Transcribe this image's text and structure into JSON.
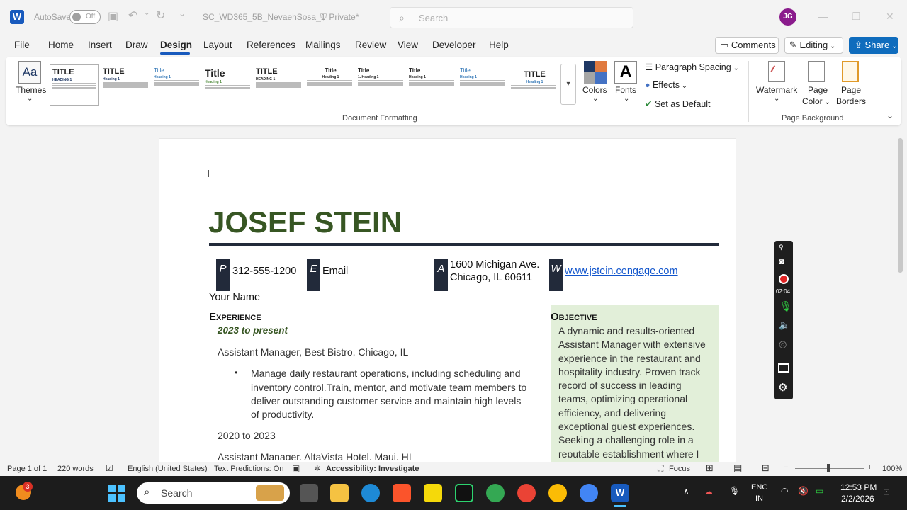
{
  "titlebar": {
    "autosave_label": "AutoSave",
    "autosave_state": "Off",
    "document_name": "SC_WD365_5B_NevaehSosa_1",
    "privacy": "Private*",
    "search_placeholder": "Search",
    "user_initials": "JG"
  },
  "menu": {
    "items": [
      "File",
      "Home",
      "Insert",
      "Draw",
      "Design",
      "Layout",
      "References",
      "Mailings",
      "Review",
      "View",
      "Developer",
      "Help"
    ],
    "active": "Design",
    "comments_label": "Comments",
    "editing_label": "Editing",
    "share_label": "Share"
  },
  "ribbon": {
    "themes_label": "Themes",
    "style_set_titles": [
      "TITLE",
      "TITLE",
      "Title",
      "Title",
      "TITLE",
      "Title",
      "Title",
      "Title",
      "Title",
      "TITLE"
    ],
    "colors_label": "Colors",
    "fonts_label": "Fonts",
    "paragraph_spacing_label": "Paragraph Spacing",
    "effects_label": "Effects",
    "set_default_label": "Set as Default",
    "document_formatting_label": "Document Formatting",
    "watermark_label": "Watermark",
    "page_color_label": "Page Color",
    "page_color_line1": "Page",
    "page_color_line2": "Color",
    "page_borders_line1": "Page",
    "page_borders_line2": "Borders",
    "page_background_label": "Page Background"
  },
  "document": {
    "name": "JOSEF STEIN",
    "contacts": [
      {
        "tag": "P",
        "text": "312-555-1200"
      },
      {
        "tag": "E",
        "text": "Email"
      },
      {
        "tag": "A",
        "line1": "1600 Michigan Ave.",
        "line2": "Chicago, IL 60611"
      },
      {
        "tag": "W",
        "text": "www.jstein.cengage.com"
      }
    ],
    "your_name": "Your Name",
    "experience_heading": "Experience",
    "date_range_1": "2023 to present",
    "position_1": "Assistant Manager, Best Bistro, Chicago, IL",
    "bullet_1_lines": [
      "Manage daily restaurant operations, including scheduling and",
      "inventory control.Train, mentor, and motivate team members to",
      "deliver outstanding customer service and maintain high levels",
      "of productivity."
    ],
    "date_range_2": "2020 to 2023",
    "position_2": "Assistant Manager, AltaVista Hotel, Maui, HI",
    "objective_heading": "Objective",
    "objective_lines": [
      "A dynamic and results-oriented",
      "Assistant Manager with extensive",
      "experience in the restaurant and",
      "hospitality industry. Proven track",
      "record of success in leading",
      "teams, optimizing operational",
      "efficiency, and delivering",
      "exceptional guest experiences.",
      "Seeking a challenging role in a",
      "reputable establishment where I"
    ]
  },
  "recorder": {
    "timer": "02:04"
  },
  "status": {
    "page": "Page 1 of 1",
    "words": "220 words",
    "language": "English (United States)",
    "predictions": "Text Predictions: On",
    "accessibility": "Accessibility: Investigate",
    "focus": "Focus",
    "zoom": "100%"
  },
  "taskbar": {
    "search_label": "Search",
    "notification_count": "3",
    "lang_line1": "ENG",
    "lang_line2": "IN",
    "time": "12:53 PM",
    "date": "2/2/2026"
  },
  "colors": {
    "accent": "#185abd",
    "name_green": "#375623",
    "objective_bg": "#e2efd9",
    "rule_navy": "#222a3a"
  }
}
